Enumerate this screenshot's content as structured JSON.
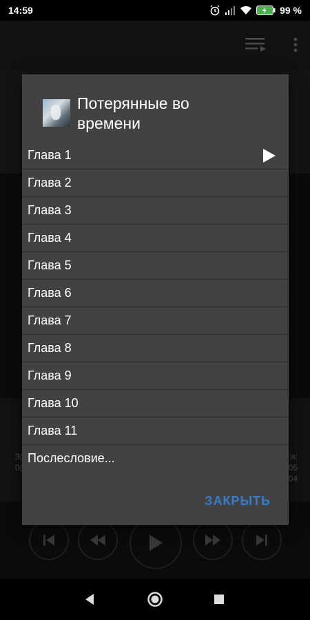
{
  "status": {
    "time": "14:59",
    "battery": "99 %"
  },
  "dialog": {
    "title": "Потерянные во времени",
    "chapters": [
      "Глава 1",
      "Глава 2",
      "Глава 3",
      "Глава 4",
      "Глава 5",
      "Глава 6",
      "Глава 7",
      "Глава 8",
      "Глава 9",
      "Глава 10",
      "Глава 11",
      "Послесловие..."
    ],
    "close_label": "ЗАКРЫТЬ"
  },
  "background": {
    "left_partial": [
      "3(",
      "0("
    ],
    "right_partial": [
      "я:",
      "05",
      "04"
    ]
  },
  "colors": {
    "accent": "#3a7bc6",
    "dialog_bg": "#424242",
    "page_bg": "#141414"
  }
}
